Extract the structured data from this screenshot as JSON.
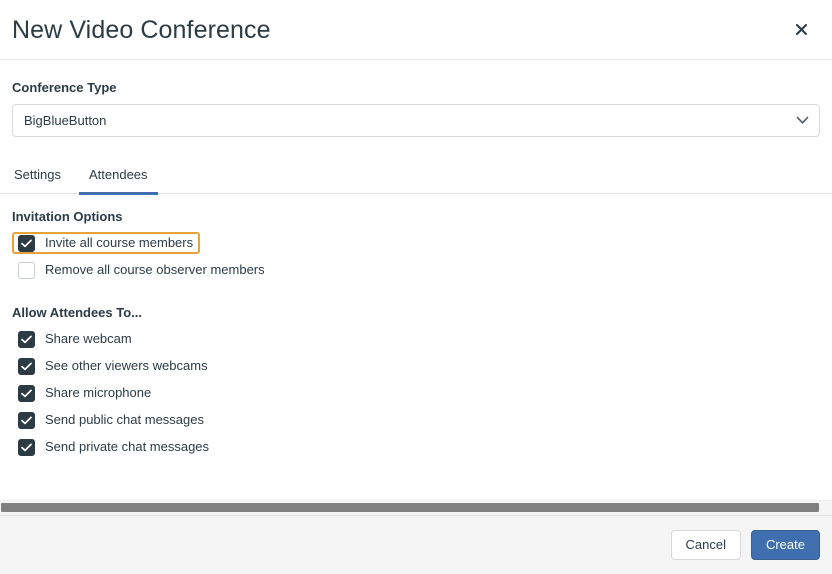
{
  "dialog": {
    "title": "New Video Conference",
    "close_icon": "close-icon"
  },
  "conference_type": {
    "label": "Conference Type",
    "selected": "BigBlueButton",
    "chevron_icon": "chevron-down-icon"
  },
  "tabs": [
    {
      "label": "Settings",
      "active": false
    },
    {
      "label": "Attendees",
      "active": true
    }
  ],
  "invitation_options": {
    "title": "Invitation Options",
    "items": [
      {
        "label": "Invite all course members",
        "checked": true,
        "highlighted": true
      },
      {
        "label": "Remove all course observer members",
        "checked": false,
        "highlighted": false
      }
    ]
  },
  "allow_attendees": {
    "title": "Allow Attendees To...",
    "items": [
      {
        "label": "Share webcam",
        "checked": true,
        "highlighted": false
      },
      {
        "label": "See other viewers webcams",
        "checked": true,
        "highlighted": false
      },
      {
        "label": "Share microphone",
        "checked": true,
        "highlighted": false
      },
      {
        "label": "Send public chat messages",
        "checked": true,
        "highlighted": false
      },
      {
        "label": "Send private chat messages",
        "checked": true,
        "highlighted": false
      }
    ]
  },
  "footer": {
    "cancel_label": "Cancel",
    "create_label": "Create"
  },
  "colors": {
    "accent_blue": "#3f6fae",
    "checkbox_dark": "#2d3b45",
    "highlight_orange": "#e5a33a",
    "text": "#2d3b45",
    "footer_bg": "#f5f5f5",
    "scrollbar_thumb": "#808080"
  }
}
